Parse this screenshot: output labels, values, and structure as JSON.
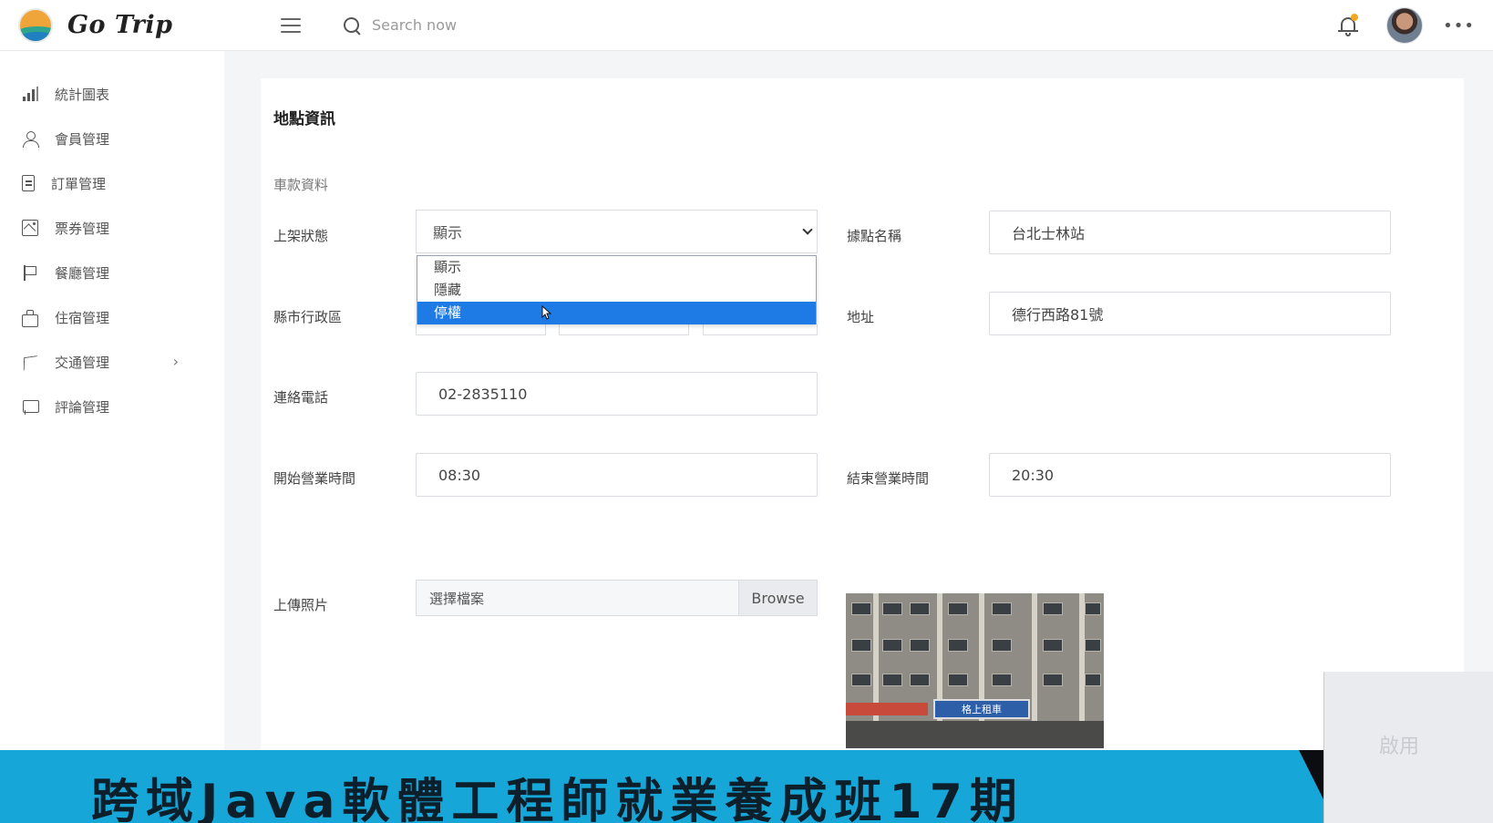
{
  "header": {
    "brand": "Go Trip",
    "search_placeholder": "Search now"
  },
  "sidebar": {
    "items": [
      {
        "label": "統計圖表",
        "icon": "chart-icon"
      },
      {
        "label": "會員管理",
        "icon": "user-icon"
      },
      {
        "label": "訂單管理",
        "icon": "document-icon"
      },
      {
        "label": "票券管理",
        "icon": "image-icon"
      },
      {
        "label": "餐廳管理",
        "icon": "flag-icon"
      },
      {
        "label": "住宿管理",
        "icon": "briefcase-icon"
      },
      {
        "label": "交通管理",
        "icon": "navigation-icon",
        "chevron": "›"
      },
      {
        "label": "評論管理",
        "icon": "chat-icon"
      }
    ]
  },
  "form": {
    "title": "地點資訊",
    "subtitle": "車款資料",
    "status": {
      "label": "上架狀態",
      "value": "顯示",
      "options": [
        "顯示",
        "隱藏",
        "停權"
      ],
      "highlighted": "停權"
    },
    "station_name": {
      "label": "據點名稱",
      "value": "台北士林站"
    },
    "district": {
      "label": "縣市行政區"
    },
    "address": {
      "label": "地址",
      "value": "德行西路81號"
    },
    "phone": {
      "label": "連絡電話",
      "value": "02-2835110"
    },
    "open_time": {
      "label": "開始營業時間",
      "value": "08:30"
    },
    "close_time": {
      "label": "結束營業時間",
      "value": "20:30"
    },
    "upload": {
      "label": "上傳照片",
      "file_text": "選擇檔案",
      "browse_label": "Browse"
    }
  },
  "photo": {
    "sign_text": "格上租車"
  },
  "overlay": {
    "banner_text": "跨域Java軟體工程師就業養成班17期",
    "corner_text": "啟用"
  },
  "colors": {
    "accent": "#1e7be6",
    "banner": "#17a6d8",
    "notification_dot": "#f5a623"
  }
}
